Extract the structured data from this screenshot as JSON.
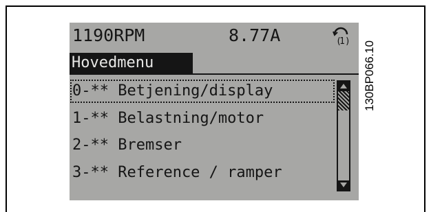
{
  "status": {
    "speed": "1190RPM",
    "current": "8.77A",
    "setup_icon": "setup-indicator-icon",
    "setup_number": "1"
  },
  "menu": {
    "title": "Hovedmenu",
    "items": [
      {
        "label": "0-** Betjening/display",
        "selected": true
      },
      {
        "label": "1-** Belastning/motor",
        "selected": false
      },
      {
        "label": "2-** Bremser",
        "selected": false
      },
      {
        "label": "3-** Reference / ramper",
        "selected": false
      }
    ]
  },
  "figure_code": "130BP066.10"
}
